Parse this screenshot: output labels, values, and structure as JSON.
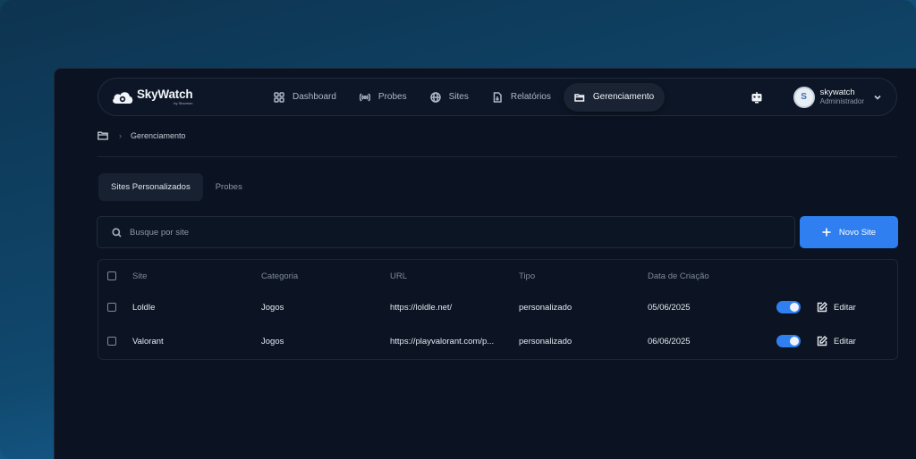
{
  "nav": {
    "brand": "SkyWatch",
    "brand_sub": "by Sinomon",
    "items": [
      {
        "label": "Dashboard",
        "icon": "grid-icon"
      },
      {
        "label": "Probes",
        "icon": "broadcast-icon"
      },
      {
        "label": "Sites",
        "icon": "globe-icon"
      },
      {
        "label": "Relatórios",
        "icon": "report-icon"
      },
      {
        "label": "Gerenciamento",
        "icon": "folder-icon",
        "active": true
      }
    ],
    "user": {
      "name": "skywatch",
      "role": "Administrador",
      "avatar_letter": "S"
    }
  },
  "breadcrumb": {
    "separator": "›",
    "current": "Gerenciamento"
  },
  "tabs": [
    {
      "label": "Sites Personalizados",
      "active": true
    },
    {
      "label": "Probes",
      "active": false
    }
  ],
  "search": {
    "placeholder": "Busque por site",
    "value": ""
  },
  "new_button": {
    "label": "Novo Site"
  },
  "table": {
    "columns": [
      "Site",
      "Categoria",
      "URL",
      "Tipo",
      "Data de Criação"
    ],
    "rows": [
      {
        "site": "Loldle",
        "categoria": "Jogos",
        "url": "https://loldle.net/",
        "tipo": "personalizado",
        "data": "05/06/2025",
        "enabled": true,
        "edit_label": "Editar"
      },
      {
        "site": "Valorant",
        "categoria": "Jogos",
        "url": "https://playvalorant.com/p...",
        "tipo": "personalizado",
        "data": "06/06/2025",
        "enabled": true,
        "edit_label": "Editar"
      }
    ]
  },
  "colors": {
    "accent": "#2f7ff0",
    "background": "#0b1322"
  }
}
